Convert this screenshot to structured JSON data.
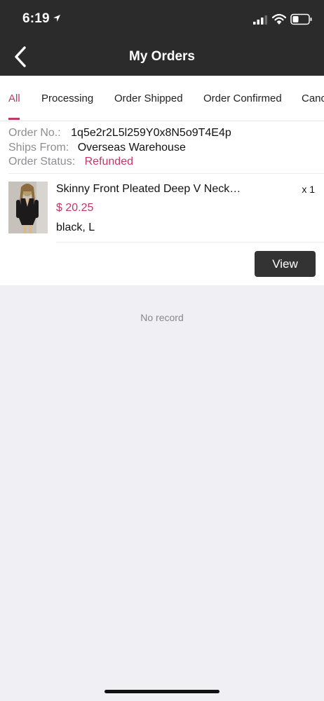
{
  "status_bar": {
    "time": "6:19"
  },
  "header": {
    "title": "My Orders"
  },
  "tabs": [
    {
      "label": "All",
      "active": true
    },
    {
      "label": "Processing",
      "active": false
    },
    {
      "label": "Order Shipped",
      "active": false
    },
    {
      "label": "Order Confirmed",
      "active": false
    },
    {
      "label": "Canc",
      "active": false
    }
  ],
  "order": {
    "order_no_label": "Order No.:",
    "order_no_value": "1q5e2r2L5l259Y0x8N5o9T4E4p",
    "ships_from_label": "Ships From:",
    "ships_from_value": "Overseas Warehouse",
    "status_label": "Order Status:",
    "status_value": "Refunded",
    "product": {
      "name": "Skinny Front Pleated Deep V Neck…",
      "quantity": "x 1",
      "price": "$ 20.25",
      "variant": "black, L"
    },
    "view_button": "View"
  },
  "empty_state": {
    "text": "No record"
  },
  "colors": {
    "accent": "#c33765",
    "header_bg": "#2b2b2b",
    "page_bg": "#efeff4",
    "button_bg": "#333333"
  }
}
